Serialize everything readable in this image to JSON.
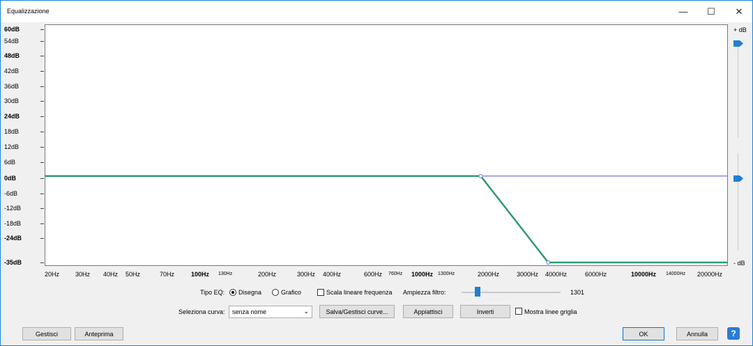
{
  "window": {
    "title": "Equalizzazione",
    "minimize_glyph": "—",
    "maximize_glyph": "☐",
    "close_glyph": "✕"
  },
  "graph": {
    "y_labels": [
      {
        "text": "60dB",
        "major": true
      },
      {
        "text": "54dB",
        "major": false
      },
      {
        "text": "48dB",
        "major": true
      },
      {
        "text": "42dB",
        "major": false
      },
      {
        "text": "36dB",
        "major": false
      },
      {
        "text": "30dB",
        "major": false
      },
      {
        "text": "24dB",
        "major": true
      },
      {
        "text": "18dB",
        "major": false
      },
      {
        "text": "12dB",
        "major": false
      },
      {
        "text": "6dB",
        "major": false
      },
      {
        "text": "0dB",
        "major": true
      },
      {
        "text": "-6dB",
        "major": false
      },
      {
        "text": "-12dB",
        "major": false
      },
      {
        "text": "-18dB",
        "major": false
      },
      {
        "text": "-24dB",
        "major": true
      },
      {
        "text": "-35dB",
        "major": true
      }
    ],
    "x_labels": [
      {
        "text": "20Hz",
        "style": "normal"
      },
      {
        "text": "30Hz",
        "style": "normal"
      },
      {
        "text": "40Hz",
        "style": "normal"
      },
      {
        "text": "50Hz",
        "style": "normal"
      },
      {
        "text": "70Hz",
        "style": "normal"
      },
      {
        "text": "100Hz",
        "style": "major"
      },
      {
        "text": "130Hz",
        "style": "small"
      },
      {
        "text": "200Hz",
        "style": "normal"
      },
      {
        "text": "300Hz",
        "style": "normal"
      },
      {
        "text": "400Hz",
        "style": "normal"
      },
      {
        "text": "600Hz",
        "style": "normal"
      },
      {
        "text": "760Hz",
        "style": "small"
      },
      {
        "text": "1000Hz",
        "style": "major"
      },
      {
        "text": "1300Hz",
        "style": "small"
      },
      {
        "text": "2000Hz",
        "style": "normal"
      },
      {
        "text": "3000Hz",
        "style": "normal"
      },
      {
        "text": "4000Hz",
        "style": "normal"
      },
      {
        "text": "6000Hz",
        "style": "normal"
      },
      {
        "text": "10000Hz",
        "style": "major"
      },
      {
        "text": "14000Hz",
        "style": "small"
      },
      {
        "text": "20000Hz",
        "style": "normal"
      }
    ],
    "right_scale_top": "+ dB",
    "right_scale_bottom": "- dB",
    "curve_color": "#2e9a6e",
    "zero_line_color": "#5555cc",
    "curve_points_db": [
      {
        "freq_hz": 20,
        "db": 0
      },
      {
        "freq_hz": 1750,
        "db": 0
      },
      {
        "freq_hz": 3500,
        "db": -35
      },
      {
        "freq_hz": 20000,
        "db": -35
      }
    ],
    "gain_max_db": 60,
    "gain_min_db": -35
  },
  "controls": {
    "eq_type_label": "Tipo EQ:",
    "draw_label": "Disegna",
    "graphic_label": "Grafico",
    "linear_scale_label": "Scala lineare frequenza",
    "filter_width_label": "Ampiezza filtro:",
    "filter_width_value": "1301",
    "select_curve_label": "Seleziona curva:",
    "curve_name": "senza nome",
    "save_manage_label": "Salva/Gestisci curve...",
    "flatten_label": "Appiattisci",
    "invert_label": "Inverti",
    "show_grid_label": "Mostra linee griglia"
  },
  "footer": {
    "manage_label": "Gestisci",
    "preview_label": "Anteprima",
    "ok_label": "OK",
    "cancel_label": "Annulla",
    "help_label": "?"
  },
  "colors": {
    "accent": "#0078d7",
    "slider_thumb": "#1e7fd6"
  }
}
